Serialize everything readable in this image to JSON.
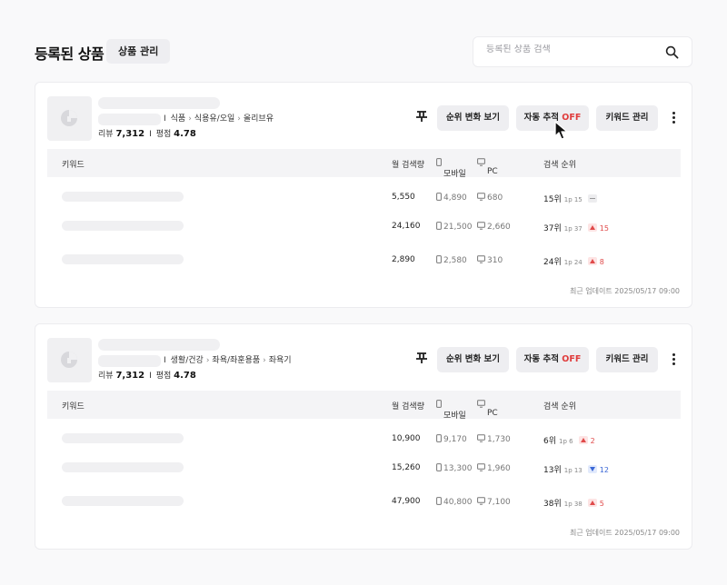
{
  "page": {
    "title": "등록된 상품",
    "manage_label": "상품 관리",
    "search_placeholder": "등록된 상품 검색"
  },
  "icons": {
    "search": "search-icon",
    "pin": "pin-icon",
    "more": "more-vertical-icon",
    "mobile": "mobile-icon",
    "pc": "monitor-icon",
    "product": "product-placeholder-icon"
  },
  "colors": {
    "off": "#e03c3c",
    "up": "#e04a4a",
    "down": "#3a67d6"
  },
  "table_headers": {
    "keyword": "키워드",
    "volume": "월 검색량",
    "mobile": "모바일",
    "pc": "PC",
    "rank": "검색 순위"
  },
  "buttons": {
    "rank_change": "순위 변화 보기",
    "auto_track": "자동 추적",
    "auto_state": "OFF",
    "keyword_manage": "키워드 관리"
  },
  "stats_labels": {
    "reviews": "리뷰",
    "rating": "평점"
  },
  "products": [
    {
      "category": [
        "식품",
        "식용유/오일",
        "올리브유"
      ],
      "reviews": "7,312",
      "rating": "4.78",
      "rows": [
        {
          "volume": "5,550",
          "mobile": "4,890",
          "pc": "680",
          "rank": "15위",
          "page": "1p 15",
          "change": "",
          "dir": "none"
        },
        {
          "volume": "24,160",
          "mobile": "21,500",
          "pc": "2,660",
          "rank": "37위",
          "page": "1p 37",
          "change": "15",
          "dir": "up"
        },
        {
          "volume": "2,890",
          "mobile": "2,580",
          "pc": "310",
          "rank": "24위",
          "page": "1p 24",
          "change": "8",
          "dir": "up"
        }
      ],
      "updated": "최근 업데이트 2025/05/17 09:00"
    },
    {
      "category": [
        "생활/건강",
        "좌욕/좌훈용품",
        "좌욕기"
      ],
      "reviews": "7,312",
      "rating": "4.78",
      "rows": [
        {
          "volume": "10,900",
          "mobile": "9,170",
          "pc": "1,730",
          "rank": "6위",
          "page": "1p 6",
          "change": "2",
          "dir": "up"
        },
        {
          "volume": "15,260",
          "mobile": "13,300",
          "pc": "1,960",
          "rank": "13위",
          "page": "1p 13",
          "change": "12",
          "dir": "down"
        },
        {
          "volume": "47,900",
          "mobile": "40,800",
          "pc": "7,100",
          "rank": "38위",
          "page": "1p 38",
          "change": "5",
          "dir": "up"
        }
      ],
      "updated": "최근 업데이트 2025/05/17 09:00"
    }
  ]
}
